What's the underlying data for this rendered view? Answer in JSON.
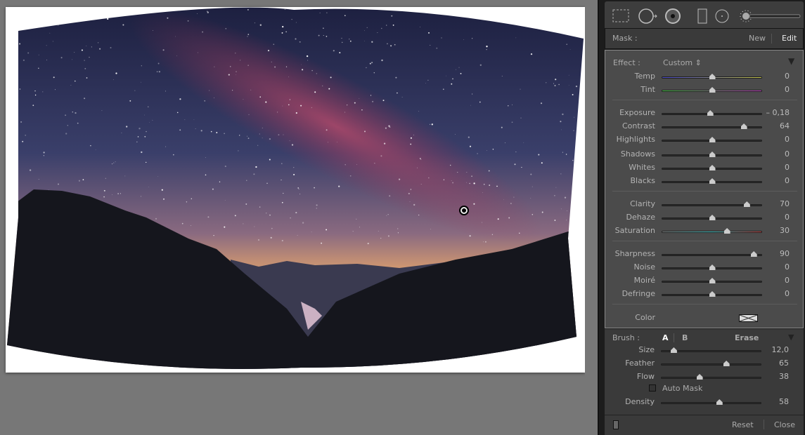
{
  "mask": {
    "label": "Mask :",
    "new": "New",
    "edit": "Edit"
  },
  "effect": {
    "label": "Effect :",
    "preset": "Custom"
  },
  "groups": [
    [
      {
        "name": "Temp",
        "value": "0",
        "pos": 0.5,
        "track": "temp"
      },
      {
        "name": "Tint",
        "value": "0",
        "pos": 0.5,
        "track": "tint"
      }
    ],
    [
      {
        "name": "Exposure",
        "value": "– 0,18",
        "pos": 0.48
      },
      {
        "name": "Contrast",
        "value": "64",
        "pos": 0.82
      },
      {
        "name": "Highlights",
        "value": "0",
        "pos": 0.5
      },
      {
        "name": "Shadows",
        "value": "0",
        "pos": 0.5
      },
      {
        "name": "Whites",
        "value": "0",
        "pos": 0.5
      },
      {
        "name": "Blacks",
        "value": "0",
        "pos": 0.5
      }
    ],
    [
      {
        "name": "Clarity",
        "value": "70",
        "pos": 0.85
      },
      {
        "name": "Dehaze",
        "value": "0",
        "pos": 0.5
      },
      {
        "name": "Saturation",
        "value": "30",
        "pos": 0.65,
        "track": "sat"
      }
    ],
    [
      {
        "name": "Sharpness",
        "value": "90",
        "pos": 0.92
      },
      {
        "name": "Noise",
        "value": "0",
        "pos": 0.5
      },
      {
        "name": "Moiré",
        "value": "0",
        "pos": 0.5
      },
      {
        "name": "Defringe",
        "value": "0",
        "pos": 0.5
      }
    ]
  ],
  "color_label": "Color",
  "brush": {
    "label": "Brush :",
    "a": "A",
    "b": "B",
    "erase": "Erase",
    "sliders": [
      {
        "name": "Size",
        "value": "12,0",
        "pos": 0.12
      },
      {
        "name": "Feather",
        "value": "65",
        "pos": 0.65
      },
      {
        "name": "Flow",
        "value": "38",
        "pos": 0.38
      },
      {
        "name": "Density",
        "value": "58",
        "pos": 0.58
      }
    ],
    "auto_mask": "Auto Mask",
    "auto_mask_checked": false
  },
  "footer": {
    "reset": "Reset",
    "close": "Close"
  },
  "colors": {
    "temp": [
      "#4a4ad0",
      "#c8c84a"
    ],
    "tint": [
      "#4ac84a",
      "#c84ac8"
    ],
    "sat": [
      "#888",
      "#4ac8c8",
      "#c84a4a"
    ]
  }
}
